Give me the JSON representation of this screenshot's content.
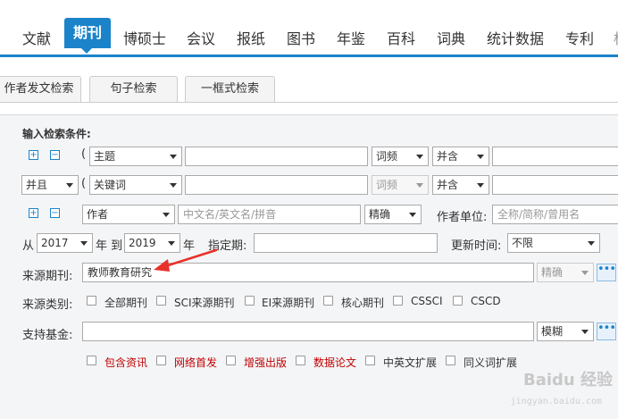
{
  "nav": {
    "items": [
      "文献",
      "期刊",
      "博硕士",
      "会议",
      "报纸",
      "图书",
      "年鉴",
      "百科",
      "词典",
      "统计数据",
      "专利"
    ],
    "active_index": 1,
    "overflow_glyph": "标"
  },
  "subtabs": [
    "作者发文检索",
    "句子检索",
    "一框式检索"
  ],
  "form": {
    "header": "输入检索条件:",
    "plus": "+",
    "minus": "−",
    "open_paren": "(",
    "row1": {
      "field": "主题",
      "match": "词频",
      "logic": "并含"
    },
    "row2": {
      "op": "并且",
      "field": "关键词",
      "match": "词频",
      "logic": "并含"
    },
    "row3": {
      "field": "作者",
      "input_placeholder": "中文名/英文名/拼音",
      "match": "精确",
      "unit_label": "作者单位:",
      "unit_placeholder": "全称/简称/曾用名"
    },
    "row4": {
      "from_label": "从",
      "from_year": "2017",
      "year_label1": "年 到",
      "to_year": "2019",
      "year_label2": "年",
      "period_label": "指定期:",
      "update_label": "更新时间:",
      "update_value": "不限"
    },
    "source_label": "来源期刊:",
    "source_value": "教师教育研究",
    "source_match": "精确",
    "more_button": "•••",
    "category_label": "来源类别:",
    "categories": [
      "全部期刊",
      "SCI来源期刊",
      "EI来源期刊",
      "核心期刊",
      "CSSCI",
      "CSCD"
    ],
    "fund_label": "支持基金:",
    "fund_match": "模糊",
    "options": [
      "包含资讯",
      "网络首发",
      "增强出版",
      "数据论文",
      "中英文扩展",
      "同义词扩展"
    ]
  },
  "watermark": {
    "text": "Baidu 经验",
    "url_text": "jingyan.baidu.com"
  },
  "colors": {
    "accent": "#1b83c9",
    "arrow": "#e8312a",
    "option_red": "#c00000"
  }
}
